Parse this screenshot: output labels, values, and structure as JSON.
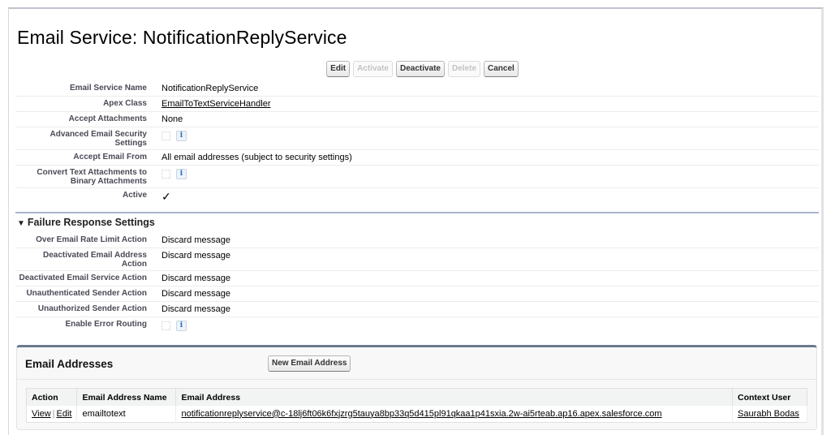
{
  "page": {
    "title": "Email Service: NotificationReplyService"
  },
  "buttons": {
    "edit": "Edit",
    "activate": "Activate",
    "deactivate": "Deactivate",
    "delete": "Delete",
    "cancel": "Cancel"
  },
  "details": {
    "email_service_name": {
      "label": "Email Service Name",
      "value": "NotificationReplyService"
    },
    "apex_class": {
      "label": "Apex Class",
      "value": "EmailToTextServiceHandler"
    },
    "accept_attachments": {
      "label": "Accept Attachments",
      "value": "None"
    },
    "advanced_security": {
      "label": "Advanced Email Security Settings",
      "checked": false,
      "info_icon": "i"
    },
    "accept_email_from": {
      "label": "Accept Email From",
      "value": "All email addresses (subject to security settings)"
    },
    "convert_text_attachments": {
      "label_line1": "Convert Text Attachments to",
      "label_line2": "Binary Attachments",
      "checked": false,
      "info_icon": "i"
    },
    "active": {
      "label": "Active",
      "checked": true,
      "check_glyph": "✓"
    }
  },
  "failure_section": {
    "toggle_glyph": "▼",
    "title": "Failure Response Settings",
    "rows": [
      {
        "label": "Over Email Rate Limit Action",
        "value": "Discard message"
      },
      {
        "label": "Deactivated Email Address Action",
        "value": "Discard message"
      },
      {
        "label": "Deactivated Email Service Action",
        "value": "Discard message"
      },
      {
        "label": "Unauthenticated Sender Action",
        "value": "Discard message"
      },
      {
        "label": "Unauthorized Sender Action",
        "value": "Discard message"
      }
    ],
    "error_routing": {
      "label": "Enable Error Routing",
      "checked": false,
      "info_icon": "i"
    }
  },
  "email_addresses": {
    "title": "Email Addresses",
    "new_button": "New Email Address",
    "columns": [
      "Action",
      "Email Address Name",
      "Email Address",
      "Context User"
    ],
    "rows": [
      {
        "view": "View",
        "separator": "|",
        "edit": "Edit",
        "name": "emailtotext",
        "address": "notificationreplyservice@c-18lj6ft06k6fxjzrg5tauya8bp33q5d415pl91qkaa1p41sxia.2w-ai5rteab.ap16.apex.salesforce.com",
        "context_user": "Saurabh Bodas"
      }
    ]
  },
  "colors": {
    "section_border": "#a9b5cf",
    "related_list_border": "#6c7a91",
    "label_text": "#4a4a56"
  }
}
